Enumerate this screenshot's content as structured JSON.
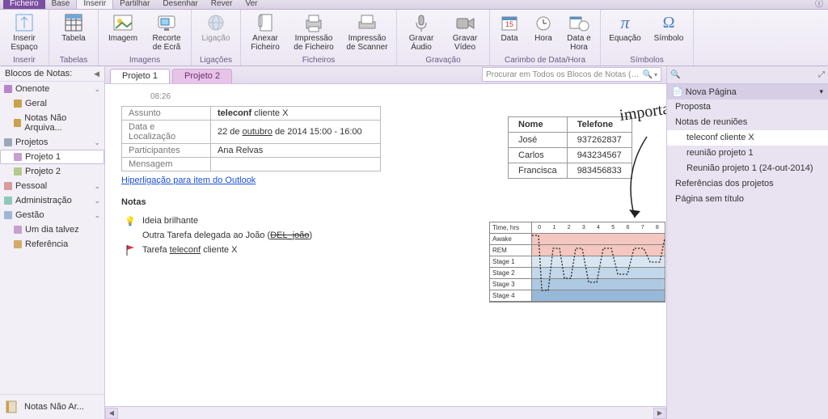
{
  "ribbon": {
    "tabs": [
      "Ficheiro",
      "Base",
      "Inserir",
      "Partilhar",
      "Desenhar",
      "Rever",
      "Ver"
    ],
    "active_tab": "Inserir",
    "groups": {
      "inserir": {
        "title": "Inserir",
        "items": [
          {
            "label": "Inserir Espaço",
            "name": "insert-space"
          }
        ]
      },
      "tabelas": {
        "title": "Tabelas",
        "items": [
          {
            "label": "Tabela",
            "name": "table"
          }
        ]
      },
      "imagens": {
        "title": "Imagens",
        "items": [
          {
            "label": "Imagem",
            "name": "picture"
          },
          {
            "label": "Recorte de Ecrã",
            "name": "screen-clipping"
          }
        ]
      },
      "ligacoes": {
        "title": "Ligações",
        "items": [
          {
            "label": "Ligação",
            "name": "link"
          }
        ]
      },
      "ficheiros": {
        "title": "Ficheiros",
        "items": [
          {
            "label": "Anexar Ficheiro",
            "name": "attach-file"
          },
          {
            "label": "Impressão de Ficheiro",
            "name": "file-printout"
          },
          {
            "label": "Impressão de Scanner",
            "name": "scanner-printout"
          }
        ]
      },
      "gravacao": {
        "title": "Gravação",
        "items": [
          {
            "label": "Gravar Áudio",
            "name": "record-audio"
          },
          {
            "label": "Gravar Vídeo",
            "name": "record-video"
          }
        ]
      },
      "carimbo": {
        "title": "Carimbo de Data/Hora",
        "items": [
          {
            "label": "Data",
            "name": "date"
          },
          {
            "label": "Hora",
            "name": "time"
          },
          {
            "label": "Data e Hora",
            "name": "date-time"
          }
        ]
      },
      "simbolos": {
        "title": "Símbolos",
        "items": [
          {
            "label": "Equação",
            "name": "equation"
          },
          {
            "label": "Símbolo",
            "name": "symbol"
          }
        ]
      }
    }
  },
  "notebooks": {
    "header": "Blocos de Notas:",
    "items": [
      {
        "label": "Onenote",
        "color": "#b984c8",
        "type": "section",
        "expand": true
      },
      {
        "label": "Geral",
        "color": "#c9a24b",
        "type": "sub"
      },
      {
        "label": "Notas Não Arquiva...",
        "color": "#c9a24b",
        "type": "sub"
      },
      {
        "label": "Projetos",
        "color": "#9aa8b5",
        "type": "section",
        "expand": true
      },
      {
        "label": "Projeto 1",
        "color": "#c7a0cf",
        "type": "sub",
        "selected": true
      },
      {
        "label": "Projeto 2",
        "color": "#b3c98e",
        "type": "sub"
      },
      {
        "label": "Pessoal",
        "color": "#d99aa0",
        "type": "section",
        "expand": true
      },
      {
        "label": "Administração",
        "color": "#8fc6bd",
        "type": "section",
        "expand": true
      },
      {
        "label": "Gestão",
        "color": "#9fb7d6",
        "type": "section",
        "expand": true
      },
      {
        "label": "Um dia talvez",
        "color": "#c7a0cf",
        "type": "sub"
      },
      {
        "label": "Referência",
        "color": "#d4a96a",
        "type": "sub"
      }
    ],
    "footer": "Notas Não Ar..."
  },
  "page_tabs": {
    "items": [
      "Projeto 1",
      "Projeto 2"
    ],
    "active": 0
  },
  "search": {
    "placeholder": "Procurar em Todos os Blocos de Notas (Ctrl+E)"
  },
  "page": {
    "timestamp": "08:26",
    "meta": {
      "assunto_k": "Assunto",
      "assunto_v": "teleconf cliente X",
      "data_k": "Data e Localização",
      "data_v": "22 de outubro de 2014 15:00 - 16:00",
      "part_k": "Participantes",
      "part_v": "Ana Relvas",
      "msg_k": "Mensagem",
      "msg_v": ""
    },
    "outlook_link": "Hiperligação para item do Outlook",
    "notes_header": "Notas",
    "notes": [
      {
        "tag": "idea",
        "text": "Ideia brilhante"
      },
      {
        "tag": "",
        "prefix": "Outra Tarefa delegada ao João (",
        "del": "DEL_joão",
        "suffix": ")"
      },
      {
        "tag": "flag",
        "prefix": "Tarefa ",
        "u": "teleconf",
        "suffix": " cliente X"
      }
    ],
    "contacts": {
      "headers": [
        "Nome",
        "Telefone"
      ],
      "rows": [
        [
          "José",
          "937262837"
        ],
        [
          "Carlos",
          "943234567"
        ],
        [
          "Francisca",
          "983456833"
        ]
      ]
    },
    "ink": "importante",
    "sleep": {
      "timehdr": "Time, hrs",
      "ticks": [
        "0",
        "1",
        "2",
        "3",
        "4",
        "5",
        "6",
        "7",
        "8"
      ],
      "rows": [
        "Awake",
        "REM",
        "Stage 1",
        "Stage 2",
        "Stage 3",
        "Stage 4"
      ]
    }
  },
  "pagelist": {
    "new": "Nova Página",
    "items": [
      {
        "label": "Proposta"
      },
      {
        "label": "Notas de reuniões"
      },
      {
        "label": "teleconf cliente X",
        "sub": true,
        "selected": true
      },
      {
        "label": "reunião projeto 1",
        "sub": true
      },
      {
        "label": "Reunião projeto 1 (24-out-2014)",
        "sub": true
      },
      {
        "label": "Referências dos projetos"
      },
      {
        "label": "Página sem título"
      }
    ]
  }
}
